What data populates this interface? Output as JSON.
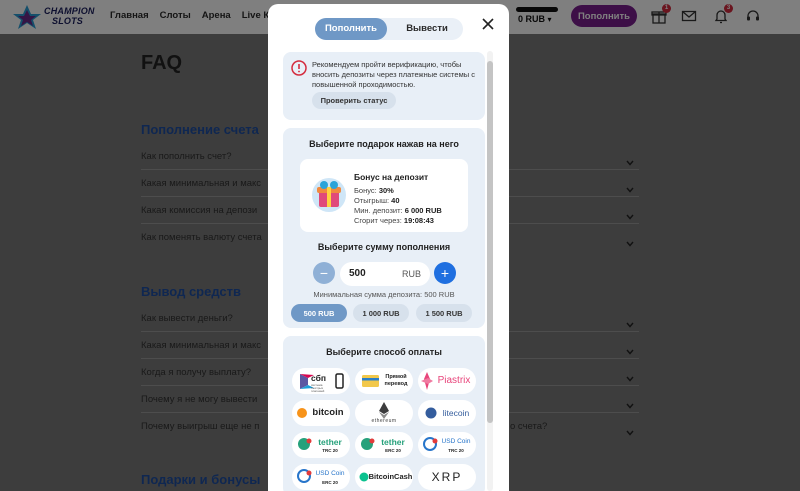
{
  "header": {
    "logo_line1": "CHAMPION",
    "logo_line2": "SLOTS",
    "nav": [
      "Главная",
      "Слоты",
      "Арена",
      "Live Ка"
    ],
    "balance": "0 RUB",
    "deposit_label": "Пополнить",
    "gift_badge": "1",
    "bell_badge": "3",
    "icons": [
      "gift-icon",
      "mail-icon",
      "bell-icon",
      "support-headset-icon"
    ]
  },
  "faq": {
    "title": "FAQ",
    "sections": [
      {
        "title": "Пополнение счета",
        "questions": [
          "Как пополнить счет?",
          "Какая минимальная и макс",
          "Какая комиссия на депози",
          "Как поменять валюту счета"
        ]
      },
      {
        "title": "Вывод средств",
        "questions": [
          "Как вывести деньги?",
          "Какая минимальная и макс",
          "Когда я получу выплату?",
          "Почему я не могу вывести",
          "Почему выигрыш еще не п"
        ]
      },
      {
        "title": "Подарки и бонусы",
        "questions": []
      }
    ],
    "question_tail": "о счета?"
  },
  "modal": {
    "tabs": [
      "Пополнить",
      "Вывести"
    ],
    "alert": {
      "text": "Рекомендуем пройти верификацию, чтобы вносить депозиты через платежные системы с повышенной проходимостью.",
      "button": "Проверить статус"
    },
    "gift": {
      "title": "Выберите подарок нажав на него",
      "bonus_name": "Бонус на депозит",
      "lines": [
        {
          "label": "Бонус:",
          "value": "30%"
        },
        {
          "label": "Отыгрыш:",
          "value": "40"
        },
        {
          "label": "Мин. депозит:",
          "value": "6 000 RUB"
        },
        {
          "label": "Сгорит через:",
          "value": "19:08:43"
        }
      ]
    },
    "amount": {
      "title": "Выберите сумму пополнения",
      "value": "500",
      "currency": "RUB",
      "min_note": "Минимальная сумма депозита: 500 RUB",
      "chips": [
        "500 RUB",
        "1 000 RUB",
        "1 500 RUB"
      ]
    },
    "payment": {
      "title": "Выберите способ оплаты",
      "methods": [
        {
          "name": "sbp",
          "text": "сбп",
          "sub": "система быстрых платежей"
        },
        {
          "name": "direct-transfer",
          "text": "Прямой перевод"
        },
        {
          "name": "piastrix",
          "text": "Piastrix"
        },
        {
          "name": "bitcoin",
          "text": "bitcoin"
        },
        {
          "name": "ethereum",
          "text": "ethereum"
        },
        {
          "name": "litecoin",
          "text": "litecoin"
        },
        {
          "name": "tether-trc20",
          "text": "tether",
          "sub": "TRC 20"
        },
        {
          "name": "tether-erc20",
          "text": "tether",
          "sub": "ERC 20"
        },
        {
          "name": "usdcoin-trc20",
          "text": "USD Coin",
          "sub": "TRC 20"
        },
        {
          "name": "usdcoin-erc20",
          "text": "USD Coin",
          "sub": "ERC 20"
        },
        {
          "name": "bitcoincash",
          "text": "BitcoinCash"
        },
        {
          "name": "xrp",
          "text": "XRP"
        }
      ]
    }
  },
  "colors": {
    "accent_purple": "#7a1f8f",
    "link_blue": "#1f4fa3",
    "tab_active": "#6f98c6",
    "plus_blue": "#1f6fe0",
    "tether_green": "#26a17b",
    "alert_red": "#d42b3e"
  }
}
